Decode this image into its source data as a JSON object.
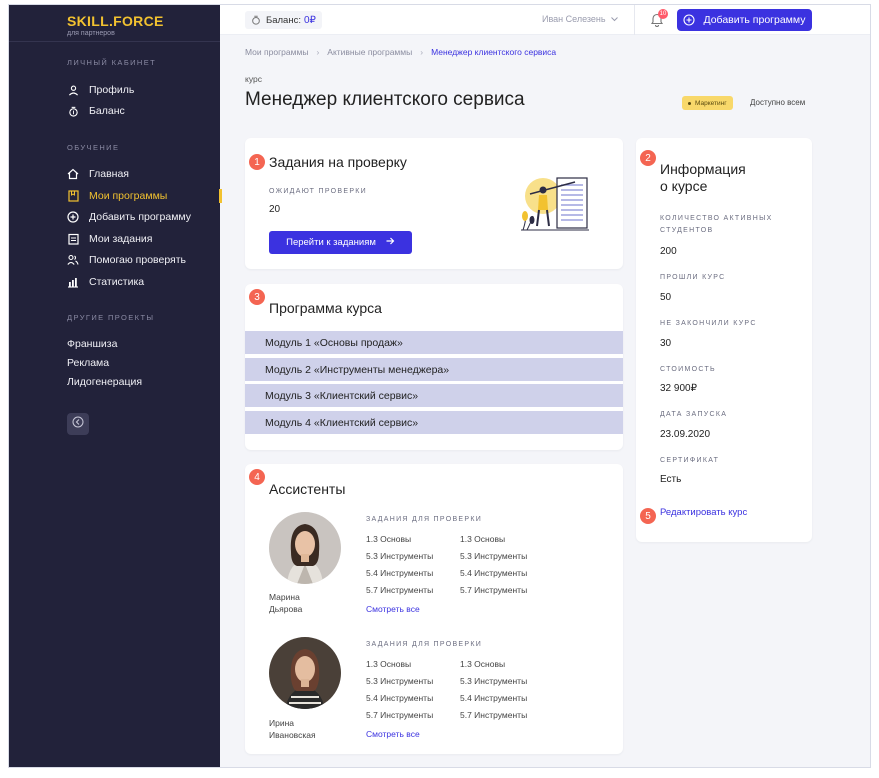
{
  "brand": {
    "title": "SKILL.FORCE",
    "subtitle": "для партнеров",
    "accent": "#f2c230"
  },
  "sidebar": {
    "sections": [
      {
        "title": "ЛИЧНЫЙ КАБИНЕТ"
      },
      {
        "title": "ОБУЧЕНИЕ"
      },
      {
        "title": "ДРУГИЕ ПРОЕКТЫ"
      }
    ],
    "personal": [
      {
        "label": "Профиль",
        "icon": "user-icon"
      },
      {
        "label": "Баланс",
        "icon": "coins-icon"
      }
    ],
    "learning": [
      {
        "label": "Главная",
        "icon": "home-icon"
      },
      {
        "label": "Мои программы",
        "icon": "bookmark-icon",
        "active": true
      },
      {
        "label": "Добавить программу",
        "icon": "plus-circle-icon"
      },
      {
        "label": "Мои задания",
        "icon": "clipboard-icon"
      },
      {
        "label": "Помогаю проверять",
        "icon": "users-icon"
      },
      {
        "label": "Статистика",
        "icon": "chart-icon"
      }
    ],
    "other": [
      "Франшиза",
      "Реклама",
      "Лидогенерация"
    ]
  },
  "topbar": {
    "balance_label": "Баланс:",
    "balance_value": "0₽",
    "user_name": "Иван Селезень",
    "notifications_count": "10",
    "add_button": "Добавить программу"
  },
  "breadcrumb": [
    "Мои программы",
    "Активные программы",
    "Менеджер клиентского сервиса"
  ],
  "page": {
    "kind": "курс",
    "title": "Менеджер клиентского сервиса",
    "tag": "Маркетинг",
    "access": "Доступно всем"
  },
  "review": {
    "badge": "1",
    "title": "Задания на проверку",
    "waiting_label": "ОЖИДАЮТ ПРОВЕРКИ",
    "waiting_value": "20",
    "button": "Перейти к заданиям"
  },
  "program": {
    "badge": "3",
    "title": "Программа курса",
    "modules": [
      "Модуль 1 «Основы продаж»",
      "Модуль 2 «Инструменты менеджера»",
      "Модуль 3 «Клиентский сервис»",
      "Модуль 4 «Клиентский сервис»"
    ]
  },
  "assistants": {
    "badge": "4",
    "title": "Ассистенты",
    "people": [
      {
        "name_first": "Марина",
        "name_last": "Дьярова",
        "tasks_label": "ЗАДАНИЯ ДЛЯ ПРОВЕРКИ",
        "col1": [
          "1.3 Основы",
          "5.3 Инструменты",
          "5.4 Инструменты",
          "5.7 Инструменты"
        ],
        "col2": [
          "1.3 Основы",
          "5.3 Инструменты",
          "5.4 Инструменты",
          "5.7 Инструменты"
        ],
        "see_all": "Смотреть все"
      },
      {
        "name_first": "Ирина",
        "name_last": "Ивановская",
        "tasks_label": "ЗАДАНИЯ ДЛЯ ПРОВЕРКИ",
        "col1": [
          "1.3 Основы",
          "5.3 Инструменты",
          "5.4 Инструменты",
          "5.7 Инструменты"
        ],
        "col2": [
          "1.3 Основы",
          "5.3 Инструменты",
          "5.4 Инструменты",
          "5.7 Инструменты"
        ],
        "see_all": "Смотреть все"
      }
    ]
  },
  "info": {
    "badge": "2",
    "title_line1": "Информация",
    "title_line2": "о курсе",
    "items": [
      {
        "label_line1": "КОЛИЧЕСТВО АКТИВНЫХ",
        "label_line2": "СТУДЕНТОВ",
        "value": "200"
      },
      {
        "label_line1": "ПРОШЛИ КУРС",
        "value": "50"
      },
      {
        "label_line1": "НЕ ЗАКОНЧИЛИ КУРС",
        "value": "30"
      },
      {
        "label_line1": "СТОИМОСТЬ",
        "value": "32 900₽"
      },
      {
        "label_line1": "ДАТА ЗАПУСКА",
        "value": "23.09.2020"
      },
      {
        "label_line1": "СЕРТИФИКАТ",
        "value": "Есть"
      }
    ],
    "edit_badge": "5",
    "edit_link": "Редактировать курс"
  },
  "colors": {
    "primary": "#3b32e0",
    "sidebar": "#22223a",
    "badge": "#f46552",
    "module_bg": "#cfd1ea",
    "tag": "#f8d86a"
  }
}
